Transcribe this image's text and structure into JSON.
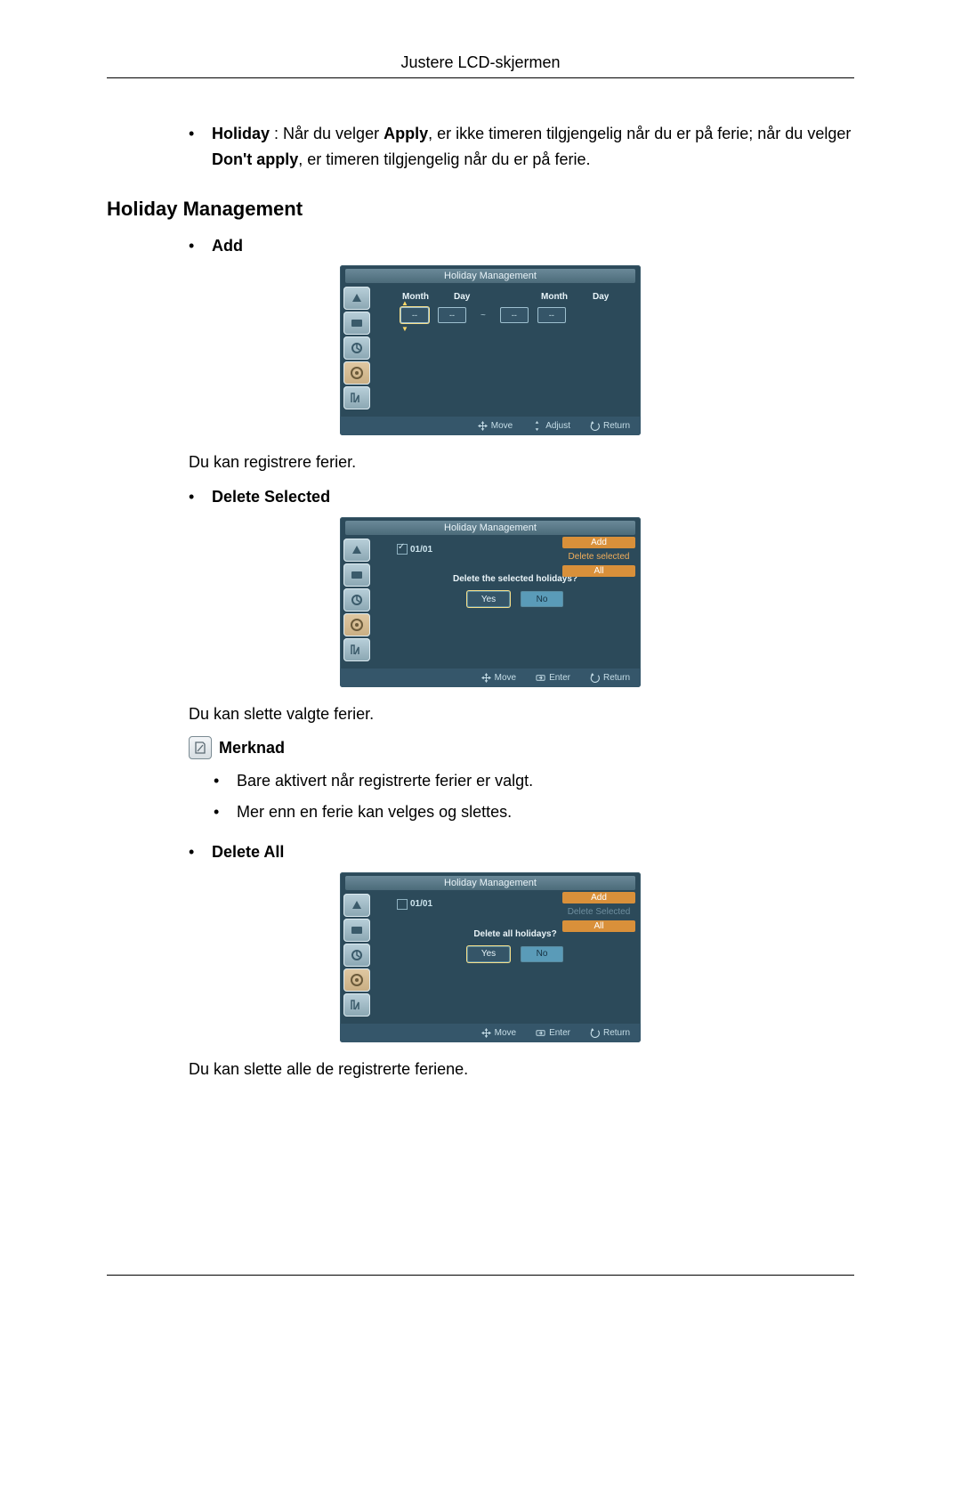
{
  "header": {
    "title": "Justere LCD-skjermen"
  },
  "intro_bullet": {
    "strong1": "Holiday",
    "text1": " : Når du velger ",
    "strong2": "Apply",
    "text2": ", er ikke timeren tilgjengelig når du er på ferie; når du velger ",
    "strong3": "Don't apply",
    "text3": ", er timeren tilgjengelig når du er på ferie."
  },
  "section_title": "Holiday Management",
  "add": {
    "label": "Add",
    "osd_title": "Holiday Management",
    "col_month": "Month",
    "col_day": "Day",
    "dash": "--",
    "tilde": "~",
    "foot_move": "Move",
    "foot_adjust": "Adjust",
    "foot_return": "Return",
    "desc": "Du kan registrere ferier."
  },
  "delsel": {
    "label": "Delete Selected",
    "osd_title": "Holiday Management",
    "date": "01/01",
    "act_add": "Add",
    "act_delsel": "Delete selected",
    "act_all": "All",
    "question": "Delete the selected holidays?",
    "yes": "Yes",
    "no": "No",
    "foot_move": "Move",
    "foot_enter": "Enter",
    "foot_return": "Return",
    "desc": "Du kan slette valgte ferier."
  },
  "note": {
    "label": "Merknad",
    "items": [
      "Bare aktivert når registrerte ferier er valgt.",
      "Mer enn en ferie kan velges og slettes."
    ]
  },
  "delall": {
    "label": "Delete All",
    "osd_title": "Holiday Management",
    "date": "01/01",
    "act_add": "Add",
    "act_delsel": "Delete Selected",
    "act_all": "All",
    "question": "Delete all holidays?",
    "yes": "Yes",
    "no": "No",
    "foot_move": "Move",
    "foot_enter": "Enter",
    "foot_return": "Return",
    "desc": "Du kan slette alle de registrerte feriene."
  }
}
